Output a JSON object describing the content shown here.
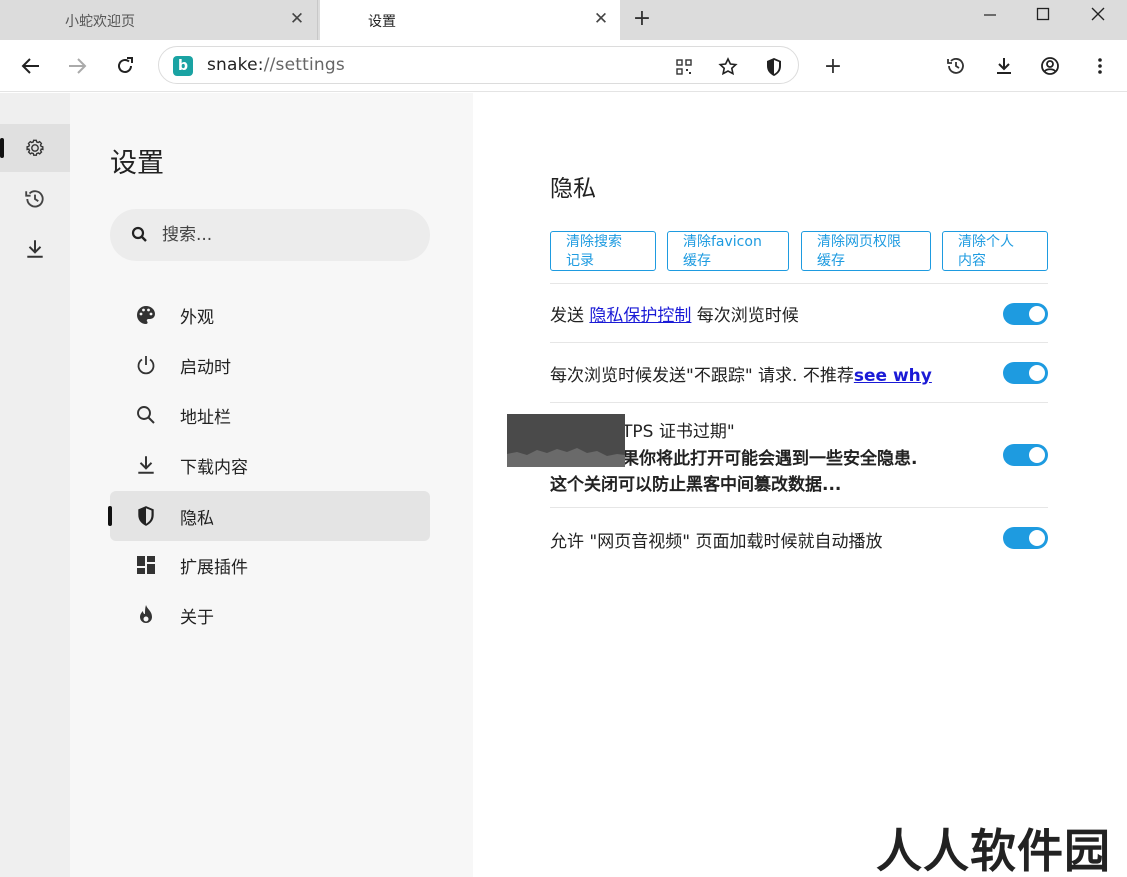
{
  "tabs": [
    {
      "title": "小蛇欢迎页",
      "close": "✕"
    },
    {
      "title": "设置",
      "close": "✕"
    }
  ],
  "new_tab": "+",
  "address": {
    "scheme": "snake:",
    "rest": "//settings",
    "site_icon": "b"
  },
  "toolbar_plus": "+",
  "rail": [
    {
      "icon": "gear-icon"
    },
    {
      "icon": "history-icon"
    },
    {
      "icon": "download-icon"
    }
  ],
  "nav": {
    "title": "设置",
    "search_placeholder": "搜索...",
    "items": [
      {
        "label": "外观",
        "icon": "palette-icon"
      },
      {
        "label": "启动时",
        "icon": "power-icon"
      },
      {
        "label": "地址栏",
        "icon": "search-icon"
      },
      {
        "label": "下载内容",
        "icon": "download-icon"
      },
      {
        "label": "隐私",
        "icon": "shield-icon"
      },
      {
        "label": "扩展插件",
        "icon": "dashboard-icon"
      },
      {
        "label": "关于",
        "icon": "flame-icon"
      }
    ],
    "active_index": 4
  },
  "main": {
    "section_title": "隐私",
    "chips": [
      {
        "line1": "清除搜索",
        "line2": "记录"
      },
      {
        "line1": "清除favicon",
        "line2": "缓存"
      },
      {
        "line1": "清除网页权限",
        "line2": "缓存"
      },
      {
        "line1": "清除个人",
        "line2": "内容"
      }
    ],
    "rows": [
      {
        "pre": "发送 ",
        "link": "隐私保护控制",
        "post": " 每次浏览时候",
        "on": true
      },
      {
        "pre": "每次浏览时候发送\"不跟踪\" 请求. 不推荐",
        "link": "see why",
        "on": true
      },
      {
        "line1": "TPS 证书过期\"",
        "line2": "果你将此打开可能会遇到一些安全隐患.",
        "line3": "这个关闭可以防止黑客中间篡改数据...",
        "on": true
      },
      {
        "text": "允许 \"网页音视频\" 页面加载时候就自动播放",
        "on": true
      }
    ]
  },
  "accent": "#1e9be0",
  "watermark": "人人软件园"
}
